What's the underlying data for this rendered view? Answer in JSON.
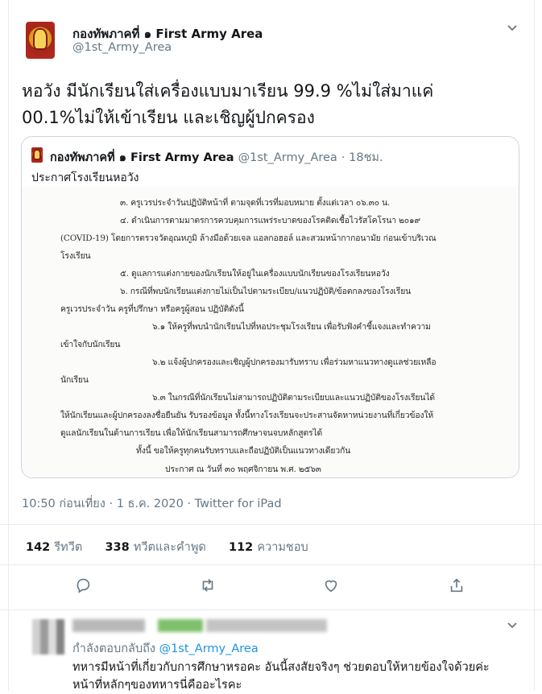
{
  "tweet": {
    "author_name": "กองทัพภาคที่ ๑ First Army Area",
    "author_handle": "@1st_Army_Area",
    "text_line1": "หอวัง มีนักเรียนใส่เครื่องแบบมาเรียน 99.9  %ไม่ใส่มาแค่",
    "text_line2": "00.1%ไม่ให้เข้าเรียน และเชิญผู้ปกครอง",
    "timestamp": "10:50 ก่อนเที่ยง · 1 ธ.ค. 2020 · Twitter for iPad",
    "stats": {
      "retweets_count": "142",
      "retweets_label": "รีทวีต",
      "quotes_count": "338",
      "quotes_label": "ทวีตและคำพูด",
      "likes_count": "112",
      "likes_label": "ความชอบ"
    },
    "actions": [
      "reply-icon",
      "retweet-icon",
      "like-icon",
      "share-icon"
    ]
  },
  "quoted_tweet": {
    "author_name": "กองทัพภาคที่ ๑ First Army Area",
    "author_handle": "@1st_Army_Area",
    "time": "· 18ชม.",
    "text": "ประกาศโรงเรียนหอวัง"
  },
  "document": {
    "lines": [
      "๓.  ครูเวรประจำวันปฏิบัติหน้าที่ ตามจุดที่เวรที่มอบหมาย ตั้งแต่เวลา ๐๖.๓๐ น.",
      "๔.  ดำเนินการตามมาตรการควบคุมการแพร่ระบาดของโรคติดเชื้อไวรัสโคโรนา ๒๐๑๙",
      "(COVID-19) โดยการตรวจวัดอุณหภูมิ ล้างมือด้วยเจล แอลกอฮอล์ และสวมหน้ากากอนามัย ก่อนเข้าบริเวณ",
      "โรงเรียน",
      "๕.  ดูแลการแต่งกายของนักเรียนให้อยู่ในเครื่องแบบนักเรียนของโรงเรียนหอวัง",
      "๖.  กรณีที่พบนักเรียนแต่งกายไม่เป็นไปตามระเบียบ/แนวปฏิบัติ/ข้อตกลงของโรงเรียน",
      "ครูเวรประจำวัน ครูที่ปรึกษา หรือครูผู้สอน  ปฏิบัติดังนี้",
      "๖.๑ ให้ครูที่พบนำนักเรียนไปที่หอประชุมโรงเรียน เพื่อรับฟังคำชี้แจงและทำความ",
      "เข้าใจกับนักเรียน",
      "๖.๒ แจ้งผู้ปกครองและเชิญผู้ปกครองมารับทราบ เพื่อร่วมหาแนวทางดูแลช่วยเหลือ",
      "นักเรียน",
      "๖.๓ ในกรณีที่นักเรียนไม่สามารถปฏิบัติตามระเบียบและแนวปฏิบัติของโรงเรียนได้",
      "ให้นักเรียนและผู้ปกครองลงชื่อยืนยัน รับรองข้อมูล ทั้งนี้ทางโรงเรียนจะประสานจัดหาหน่วยงานที่เกี่ยวข้องให้",
      "ดูแลนักเรียนในด้านการเรียน เพื่อให้นักเรียนสามารถศึกษาจนจบหลักสูตรได้",
      "ทั้งนี้ ขอให้ครูทุกคนรับทราบและถือปฏิบัติเป็นแนวทางเดียวกัน",
      "ประกาศ  ณ  วันที่  ๓๐  พฤศจิกายน  พ.ศ. ๒๕๖๓"
    ]
  },
  "reply": {
    "replying_to_label": "กำลังตอบกลับถึง",
    "replying_to_handle": "@1st_Army_Area",
    "text_line1": "ทหารมีหน้าที่เกี่ยวกับการศึกษาหรอคะ อันนี้สงสัยจริงๆ ช่วยตอบให้หายข้องใจด้วยค่ะ",
    "text_line2": "หน้าที่หลักๆของทหารนี่คืออะไรคะ"
  }
}
